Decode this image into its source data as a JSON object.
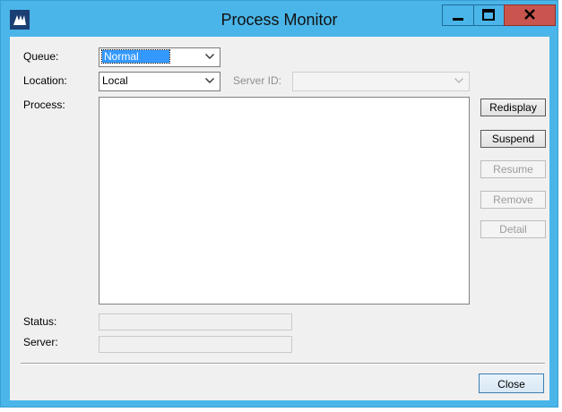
{
  "window": {
    "title": "Process Monitor",
    "app_icon": "dynamics-logo-icon",
    "controls": {
      "minimize": "minimize-icon",
      "maximize": "maximize-icon",
      "close": "close-icon"
    }
  },
  "form": {
    "queue": {
      "label": "Queue:",
      "value": "Normal"
    },
    "location": {
      "label": "Location:",
      "value": "Local"
    },
    "server_id": {
      "label": "Server ID:",
      "value": ""
    },
    "process": {
      "label": "Process:"
    },
    "status": {
      "label": "Status:",
      "value": ""
    },
    "server": {
      "label": "Server:",
      "value": ""
    }
  },
  "buttons": {
    "redisplay": "Redisplay",
    "suspend": "Suspend",
    "resume": "Resume",
    "remove": "Remove",
    "detail": "Detail",
    "close": "Close"
  },
  "colors": {
    "titlebar": "#4ab5e8",
    "close_button": "#c9564e",
    "selection": "#3399ff",
    "client_bg": "#f0f0f0"
  }
}
